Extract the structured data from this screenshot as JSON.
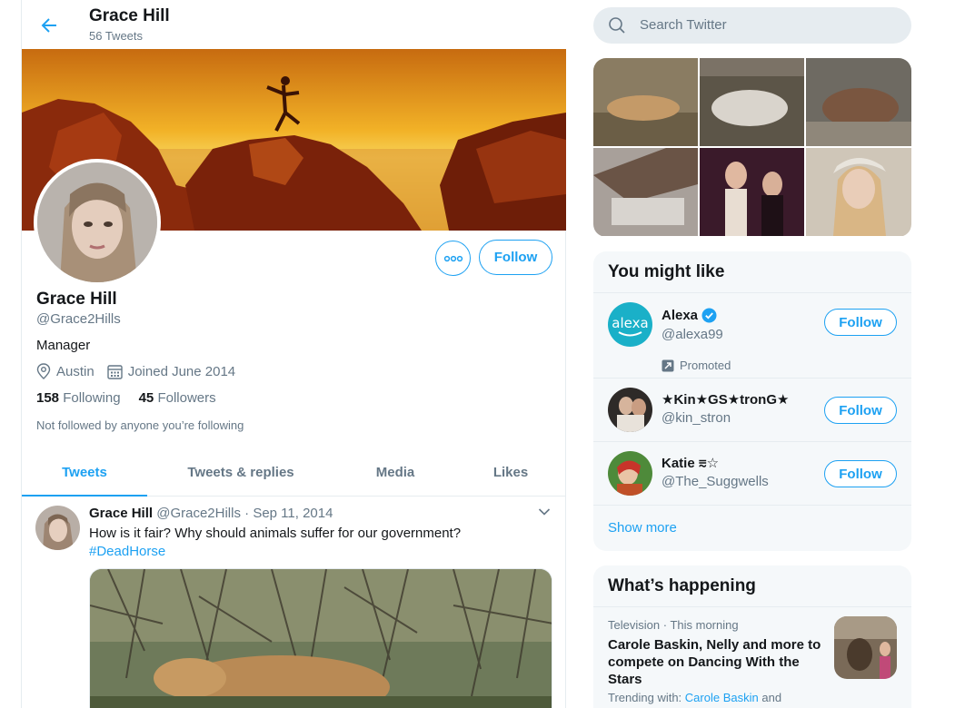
{
  "header": {
    "name": "Grace Hill",
    "tweet_count": "56 Tweets"
  },
  "profile": {
    "name": "Grace Hill",
    "handle": "@Grace2Hills",
    "bio": "Manager",
    "location": "Austin",
    "joined": "Joined June 2014",
    "following_count": "158",
    "following_label": "Following",
    "followers_count": "45",
    "followers_label": "Followers",
    "not_followed": "Not followed by anyone you’re following",
    "follow_label": "Follow"
  },
  "tabs": [
    {
      "label": "Tweets"
    },
    {
      "label": "Tweets & replies"
    },
    {
      "label": "Media"
    },
    {
      "label": "Likes"
    }
  ],
  "tweet": {
    "name": "Grace Hill",
    "handle": "@Grace2Hills",
    "separator": "·",
    "date": "Sep 11, 2014",
    "text": "How is it fair? Why should animals suffer for our government?",
    "hashtag": "#DeadHorse"
  },
  "search": {
    "placeholder": "Search Twitter"
  },
  "you_might_like": {
    "title": "You might like",
    "items": [
      {
        "name": "Alexa",
        "handle": "@alexa99",
        "promoted": "Promoted",
        "follow": "Follow"
      },
      {
        "name": "★Kin★GS★tronG★",
        "handle": "@kin_stron",
        "follow": "Follow"
      },
      {
        "name": "Katie ⩳☆",
        "handle": "@The_Suggwells",
        "follow": "Follow"
      }
    ],
    "show_more": "Show more"
  },
  "whats_happening": {
    "title": "What’s happening",
    "trend": {
      "category": "Television",
      "separator": "·",
      "time": "This morning",
      "title": "Carole Baskin, Nelly and more to compete on Dancing With the Stars",
      "trending_with_prefix": "Trending with:",
      "trending_with_link": "Carole Baskin",
      "trending_with_suffix": "and"
    }
  },
  "colors": {
    "accent": "#1da1f2",
    "text": "#14171a",
    "muted": "#657786",
    "border": "#e6ecf0",
    "card_bg": "#f5f8fa"
  },
  "icons": [
    "back-arrow-icon",
    "more-icon",
    "location-icon",
    "calendar-icon",
    "search-icon",
    "verified-icon",
    "promoted-icon",
    "chevron-down-icon"
  ]
}
